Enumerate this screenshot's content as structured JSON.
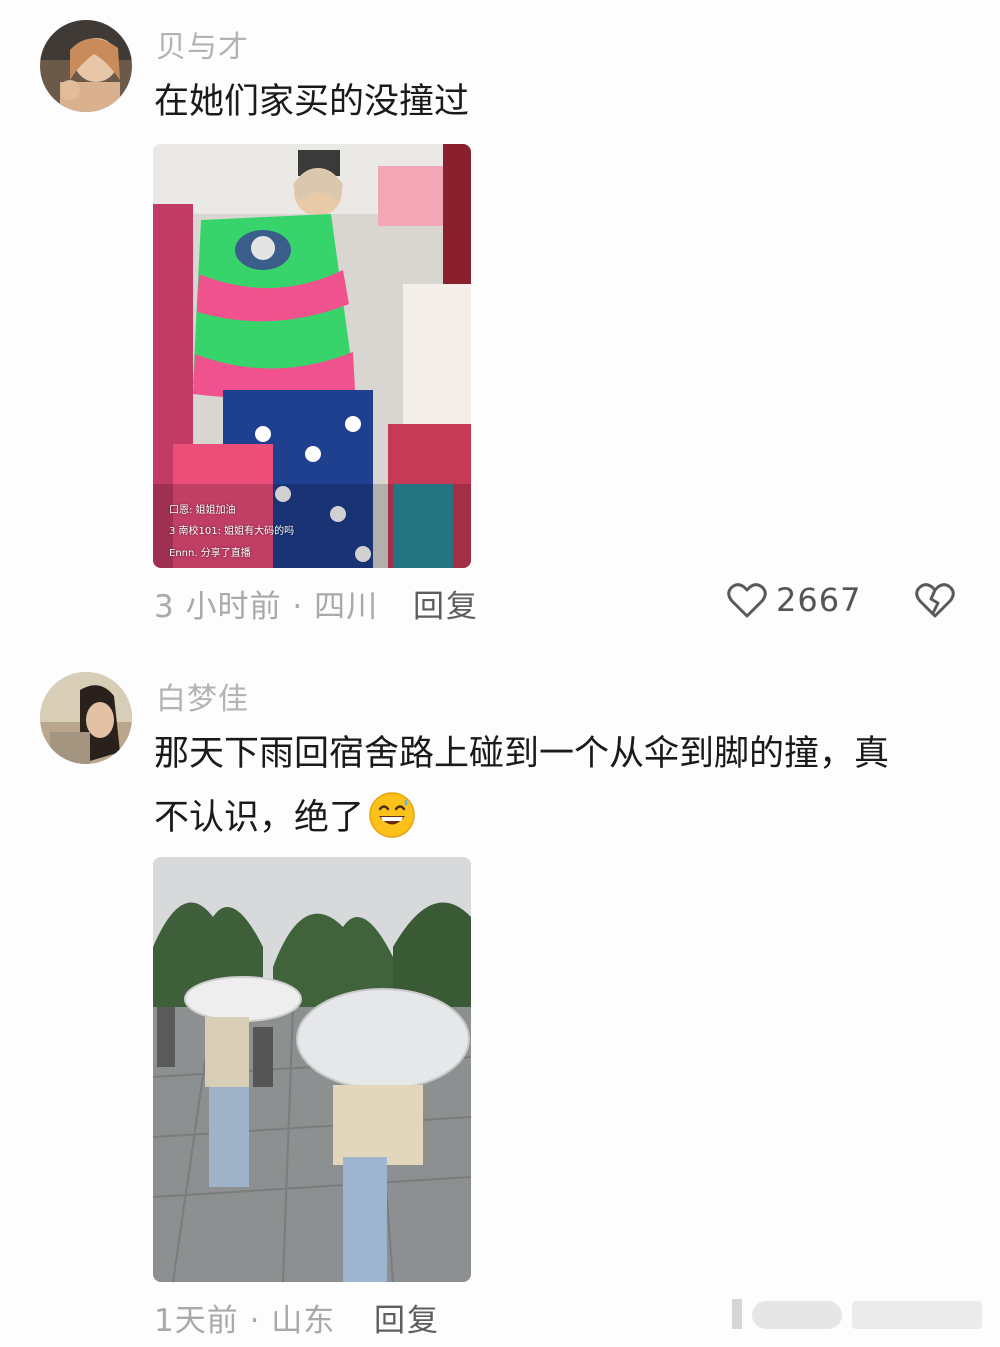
{
  "comments": [
    {
      "username": "贝与才",
      "text": "在她们家买的没撞过",
      "time_location": "3 小时前 · 四川",
      "reply_label": "回复",
      "like_count": "2667",
      "image_overlay": [
        "口恩: 姐姐加油",
        "3  南校101: 姐姐有大码的吗",
        "Ennn. 分享了直播"
      ]
    },
    {
      "username": "白梦佳",
      "text_line1": "那天下雨回宿舍路上碰到一个从伞到脚的撞，真",
      "text_line2": "不认识，绝了",
      "time_location": "1天前 · 山东",
      "reply_label": "回复"
    }
  ],
  "icons": {
    "like": "heart-icon",
    "dislike": "broken-heart-icon",
    "emoji": "grinning-sweat-emoji-icon"
  },
  "colors": {
    "background": "#fdfdfd",
    "username": "#b3b3b3",
    "text": "#1a1a1a",
    "meta": "#a9a9a9",
    "reply": "#5d5d5d"
  }
}
